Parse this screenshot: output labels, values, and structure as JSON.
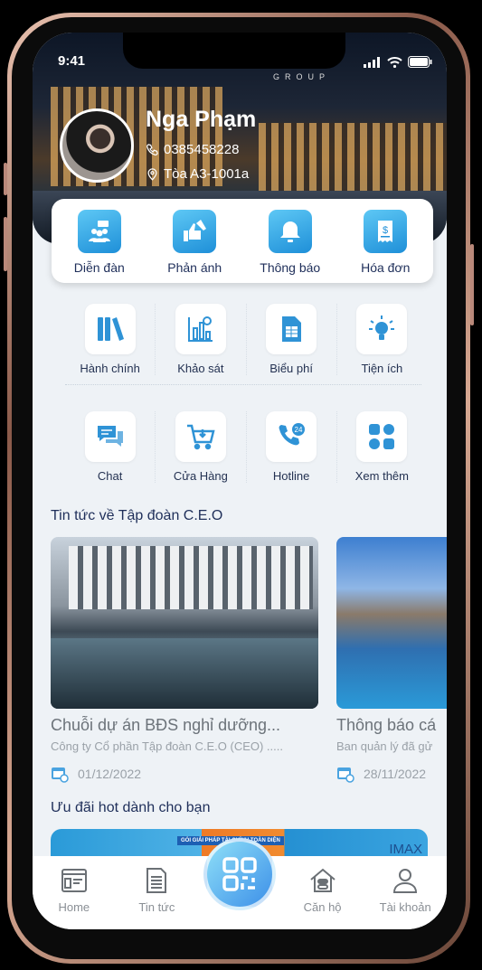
{
  "status_bar": {
    "time": "9:41"
  },
  "header": {
    "brand": "GROUP",
    "user_name": "Nga Phạm",
    "phone": "0385458228",
    "address": "Tòa A3-1001a"
  },
  "quick_actions": [
    {
      "label": "Diễn đàn",
      "icon": "forum-icon"
    },
    {
      "label": "Phản ánh",
      "icon": "feedback-icon"
    },
    {
      "label": "Thông báo",
      "icon": "bell-icon"
    },
    {
      "label": "Hóa đơn",
      "icon": "invoice-icon"
    }
  ],
  "grid_row1": [
    {
      "label": "Hành chính",
      "icon": "binders-icon"
    },
    {
      "label": "Khảo sát",
      "icon": "survey-chart-icon"
    },
    {
      "label": "Biểu phí",
      "icon": "fee-table-icon"
    },
    {
      "label": "Tiện ích",
      "icon": "lightbulb-icon"
    }
  ],
  "grid_row2": [
    {
      "label": "Chat",
      "icon": "chat-icon"
    },
    {
      "label": "Cửa Hàng",
      "icon": "cart-icon"
    },
    {
      "label": "Hotline",
      "icon": "hotline-24-icon"
    },
    {
      "label": "Xem thêm",
      "icon": "more-grid-icon"
    }
  ],
  "news": {
    "title": "Tin tức về Tập đoàn C.E.O",
    "items": [
      {
        "title": "Chuỗi dự án BĐS nghỉ dưỡng...",
        "subtitle": "Công ty Cổ phần Tập đoàn C.E.O (CEO) .....",
        "date": "01/12/2022"
      },
      {
        "title": "Thông báo cá",
        "subtitle": "Ban quản lý đã gử",
        "date": "28/11/2022"
      }
    ]
  },
  "offers": {
    "title": "Ưu đãi hot dành cho bạn",
    "banner_text": "GÓI GIẢI PHÁP TÀI CHÍNH TOÀN DIỆN",
    "banner_brand": "IMAX"
  },
  "bottom_nav": [
    {
      "label": "Home",
      "icon": "home-news-icon"
    },
    {
      "label": "Tin tức",
      "icon": "document-icon"
    },
    {
      "label": "",
      "icon": "qr-code-icon"
    },
    {
      "label": "Căn hộ",
      "icon": "apartment-icon"
    },
    {
      "label": "Tài khoản",
      "icon": "user-icon"
    }
  ],
  "colors": {
    "accent": "#1e8fd8",
    "text_dark": "#1f2f5a",
    "background": "#eef2f6"
  }
}
